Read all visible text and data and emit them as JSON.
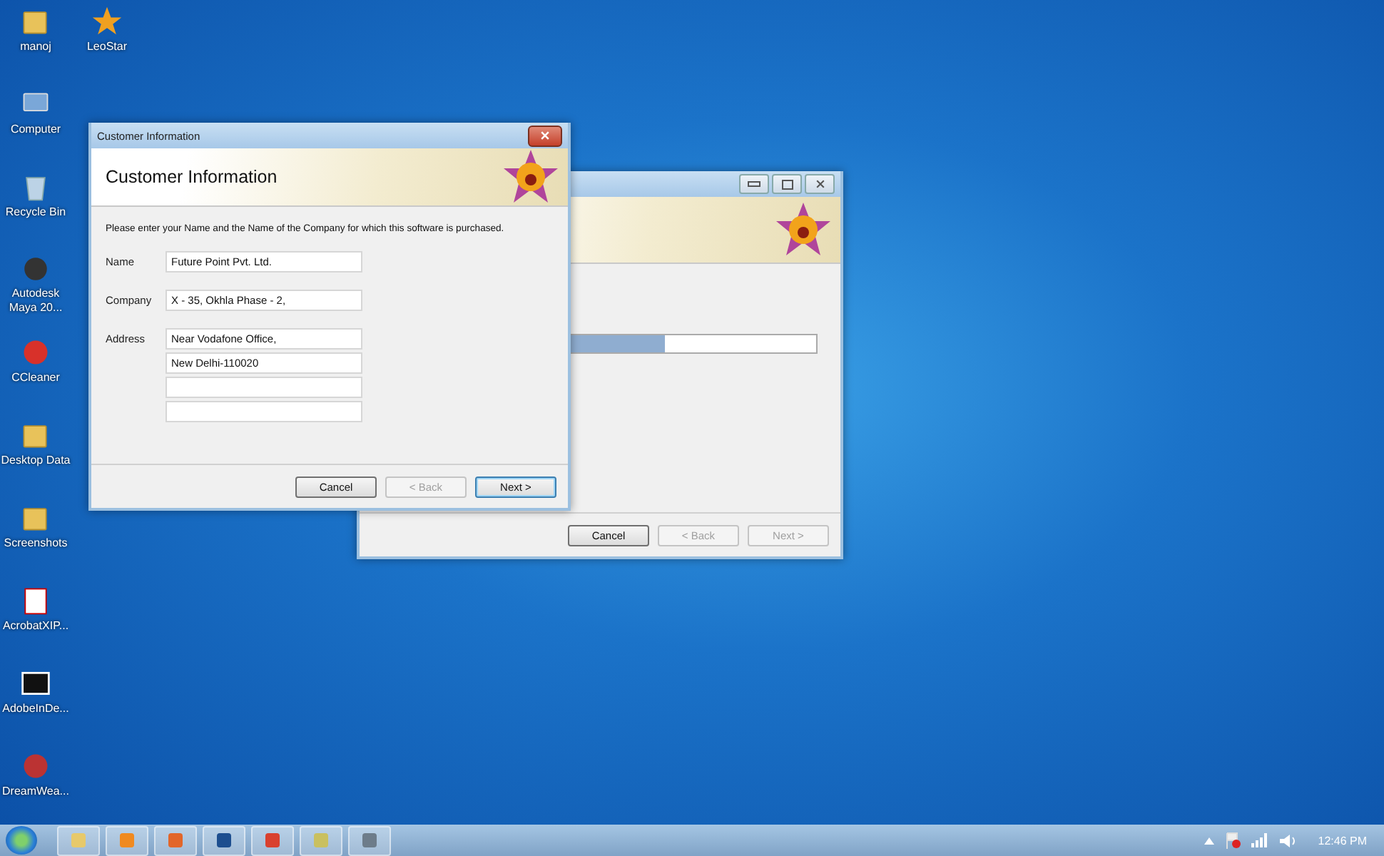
{
  "desktop_icons": [
    {
      "label": "manoj",
      "kind": "user-folder"
    },
    {
      "label": "Computer",
      "kind": "computer"
    },
    {
      "label": "Recycle Bin",
      "kind": "bin"
    },
    {
      "label": "Autodesk Maya 20...",
      "kind": "maya"
    },
    {
      "label": "CCleaner",
      "kind": "ccleaner"
    },
    {
      "label": "Desktop Data",
      "kind": "folder"
    },
    {
      "label": "Screenshots",
      "kind": "folder"
    },
    {
      "label": "AcrobatXIP...",
      "kind": "pdf"
    },
    {
      "label": "AdobeInDe...",
      "kind": "zip"
    },
    {
      "label": "DreamWea...",
      "kind": "app"
    }
  ],
  "desktop_icons_column_2": [
    {
      "label": "LeoStar",
      "kind": "leostar"
    }
  ],
  "installer_window": {
    "progress": {
      "level": 0.65
    },
    "buttons": [
      {
        "label": "Cancel",
        "disabled": false,
        "default": false
      },
      {
        "label": "< Back",
        "disabled": true,
        "default": false
      },
      {
        "label": "Next >",
        "disabled": true,
        "default": false
      }
    ]
  },
  "dialog": {
    "title": "Customer Information",
    "header": "Customer Information",
    "instruction": "Please enter your Name and the Name of the Company for which this software is purchased.",
    "fields": [
      {
        "label": "Name",
        "values": [
          "Future Point Pvt. Ltd."
        ]
      },
      {
        "label": "Company",
        "values": [
          "X - 35, Okhla Phase - 2,"
        ]
      },
      {
        "label": "Address",
        "values": [
          "Near Vodafone Office,",
          "New Delhi-110020"
        ],
        "blank_lines": [
          {
            "kind": "empty"
          },
          {
            "kind": "empty"
          }
        ]
      }
    ],
    "buttons": [
      {
        "label": "Cancel",
        "disabled": false,
        "default": false
      },
      {
        "label": "< Back",
        "disabled": true,
        "default": false
      },
      {
        "label": "Next >",
        "disabled": false,
        "default": true
      }
    ]
  },
  "taskbar": {
    "apps": [
      {
        "kind": "explorer"
      },
      {
        "kind": "media"
      },
      {
        "kind": "firefox"
      },
      {
        "kind": "photoshop"
      },
      {
        "kind": "chrome"
      },
      {
        "kind": "chart"
      },
      {
        "kind": "setup"
      }
    ],
    "clock": "12:46 PM"
  }
}
